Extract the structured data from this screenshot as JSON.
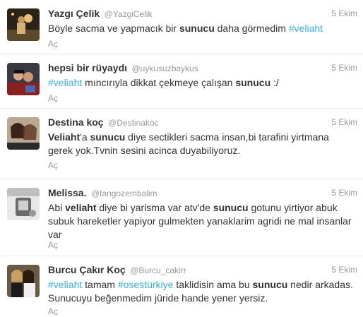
{
  "tweets": [
    {
      "name": "Yazgı Çelik",
      "handle": "@YazgiCelik",
      "time": "5 Ekim",
      "segments": [
        {
          "t": "Böyle sacma ve yapmacık bir "
        },
        {
          "t": "sunucu",
          "k": "kw"
        },
        {
          "t": " daha görmedim "
        },
        {
          "t": "#veliaht",
          "k": "tag"
        }
      ],
      "expand": "Aç"
    },
    {
      "name": "hepsi bir rüyaydı",
      "handle": "@uykusuzbaykus",
      "time": "5 Ekim",
      "segments": [
        {
          "t": "#veliaht",
          "k": "tag"
        },
        {
          "t": " mıncırıyla dikkat çekmeye çalışan "
        },
        {
          "t": "sunucu",
          "k": "kw"
        },
        {
          "t": " :/"
        }
      ],
      "expand": "Aç"
    },
    {
      "name": "Destina koç",
      "handle": "@Destinakoc",
      "time": "5 Ekim",
      "segments": [
        {
          "t": "Veliaht",
          "k": "kw"
        },
        {
          "t": "'a "
        },
        {
          "t": "sunucu",
          "k": "kw"
        },
        {
          "t": " diye sectikleri sacma insan,bi tarafini yirtmana gerek yok.Tvnin sesini acinca duyabiliyoruz."
        }
      ],
      "expand": "Aç"
    },
    {
      "name": "Melissa.",
      "handle": "@tangozembalim",
      "time": "5 Ekim",
      "segments": [
        {
          "t": "Abi "
        },
        {
          "t": "veliaht",
          "k": "kw"
        },
        {
          "t": " diye bi yarisma var atv'de "
        },
        {
          "t": "sunucu",
          "k": "kw"
        },
        {
          "t": " gotunu yirtiyor abuk subuk hareketler yapiyor gulmekten yanaklarim agridi ne mal insanlar var"
        }
      ],
      "expand": "Aç"
    },
    {
      "name": "Burcu Çakır Koç",
      "handle": "@Burcu_cakirr",
      "time": "5 Ekim",
      "segments": [
        {
          "t": "#veliaht",
          "k": "tag"
        },
        {
          "t": " tamam "
        },
        {
          "t": "#osestürkiye",
          "k": "tag"
        },
        {
          "t": " taklidisin ama bu "
        },
        {
          "t": "sunucu",
          "k": "kw"
        },
        {
          "t": " nedir arkadas. Sunucuyu beğenmedim jüride hande yener yersiz."
        }
      ],
      "expand": "Aç"
    }
  ]
}
